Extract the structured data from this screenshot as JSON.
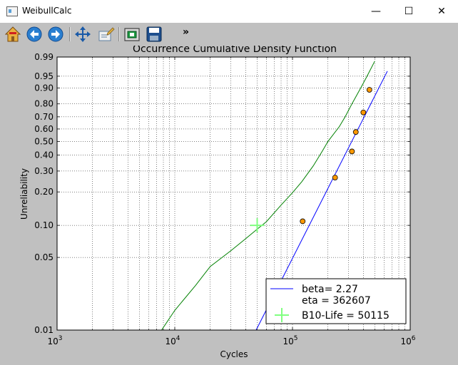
{
  "window": {
    "title": "WeibullCalc",
    "minimize_glyph": "—",
    "maximize_glyph": "☐",
    "close_glyph": "✕"
  },
  "toolbar": {
    "buttons": [
      {
        "name": "home-icon"
      },
      {
        "name": "back-icon"
      },
      {
        "name": "forward-icon"
      },
      {
        "name": "pan-icon"
      },
      {
        "name": "edit-icon"
      },
      {
        "name": "subplots-icon"
      },
      {
        "name": "save-icon"
      }
    ],
    "more": "»"
  },
  "colors": {
    "fit_line": "#0000ff",
    "cdf_line": "#008000",
    "points": "#ff9900",
    "b10_marker": "#80ff80"
  },
  "chart_data": {
    "type": "scatter",
    "title": "Occurrence Cumulative Density Function",
    "xlabel": "Cycles",
    "ylabel": "Unreliability",
    "x_scale": "log",
    "y_scale": "weibull probability",
    "xlim": [
      1000,
      1000000
    ],
    "ylim": [
      0.01,
      0.99
    ],
    "grid": true,
    "x_ticks": [
      {
        "value": 1000,
        "base": "10",
        "exp": "3"
      },
      {
        "value": 10000,
        "base": "10",
        "exp": "4"
      },
      {
        "value": 100000,
        "base": "10",
        "exp": "5"
      },
      {
        "value": 1000000,
        "base": "10",
        "exp": "6"
      }
    ],
    "y_ticks": [
      {
        "value": 0.01,
        "label": "0.01"
      },
      {
        "value": 0.05,
        "label": "0.05"
      },
      {
        "value": 0.1,
        "label": "0.10"
      },
      {
        "value": 0.2,
        "label": "0.20"
      },
      {
        "value": 0.3,
        "label": "0.30"
      },
      {
        "value": 0.4,
        "label": "0.40"
      },
      {
        "value": 0.5,
        "label": "0.50"
      },
      {
        "value": 0.6,
        "label": "0.60"
      },
      {
        "value": 0.7,
        "label": "0.70"
      },
      {
        "value": 0.8,
        "label": "0.80"
      },
      {
        "value": 0.9,
        "label": "0.90"
      },
      {
        "value": 0.95,
        "label": "0.95"
      },
      {
        "value": 0.99,
        "label": "0.99"
      }
    ],
    "series": [
      {
        "name": "beta= 2.27\neta = 362607",
        "kind": "line",
        "color": "#0000ff",
        "points": [
          [
            48000,
            0.0095
          ],
          [
            640000,
            0.965
          ]
        ]
      },
      {
        "kind": "line",
        "color": "#008000",
        "points": [
          [
            7500,
            0.0095
          ],
          [
            10000,
            0.0155
          ],
          [
            15000,
            0.027
          ],
          [
            20000,
            0.041
          ],
          [
            30000,
            0.058
          ],
          [
            40000,
            0.075
          ],
          [
            50000,
            0.092
          ],
          [
            60000,
            0.108
          ],
          [
            80000,
            0.153
          ],
          [
            100000,
            0.197
          ],
          [
            120000,
            0.245
          ],
          [
            150000,
            0.33
          ],
          [
            180000,
            0.43
          ],
          [
            200000,
            0.5
          ],
          [
            250000,
            0.62
          ],
          [
            280000,
            0.7
          ],
          [
            320000,
            0.8
          ],
          [
            380000,
            0.9
          ],
          [
            430000,
            0.95
          ],
          [
            500000,
            0.985
          ]
        ]
      },
      {
        "kind": "scatter",
        "color": "#ff9900",
        "points": [
          [
            122000,
            0.109
          ],
          [
            230000,
            0.265
          ],
          [
            320000,
            0.425
          ],
          [
            345000,
            0.575
          ],
          [
            400000,
            0.735
          ],
          [
            450000,
            0.89
          ]
        ]
      },
      {
        "name": "B10-Life = 50115",
        "kind": "marker",
        "color": "#80ff80",
        "points": [
          [
            50115,
            0.1
          ]
        ]
      }
    ],
    "legend": {
      "placement": "lower-right",
      "entries": [
        {
          "lines": [
            "beta= 2.27",
            "eta = 362607"
          ],
          "color": "#0000ff",
          "kind": "line"
        },
        {
          "lines": [
            "B10-Life = 50115"
          ],
          "color": "#80ff80",
          "kind": "marker"
        }
      ]
    }
  }
}
